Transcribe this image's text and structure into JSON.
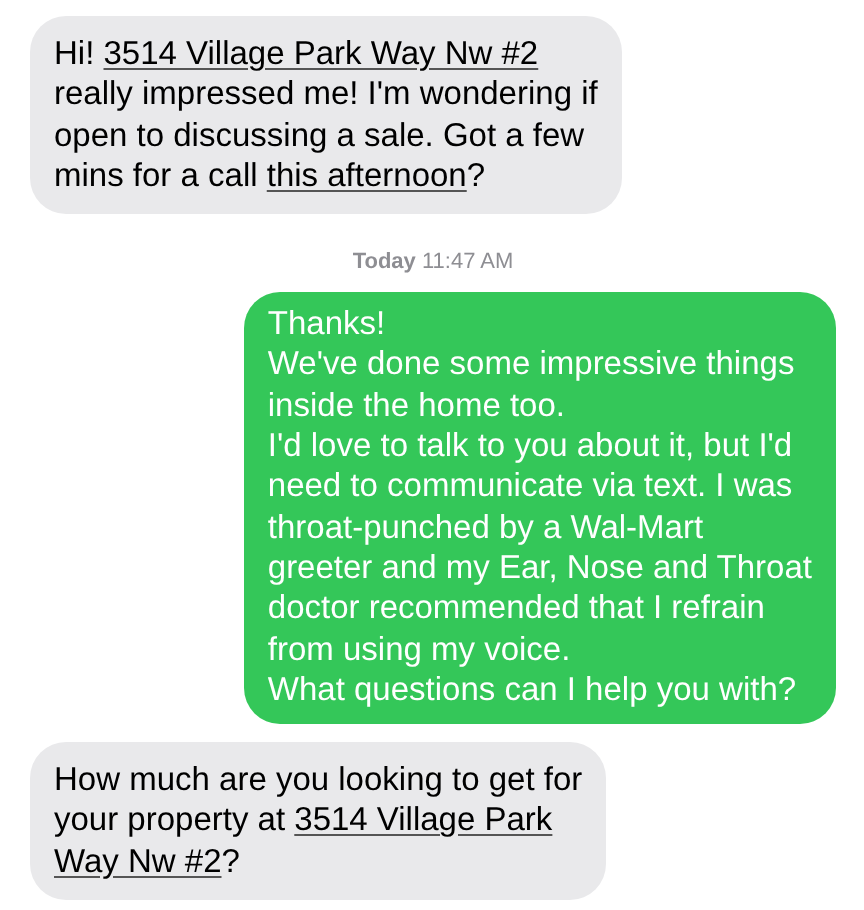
{
  "messages": [
    {
      "kind": "incoming",
      "lines": [
        [
          {
            "kind": "text",
            "text": "Hi! "
          },
          {
            "kind": "link",
            "text": "3514 Village Park Way Nw #2"
          }
        ],
        [
          {
            "kind": "text",
            "text": "really impressed me! I'm wondering if"
          }
        ],
        [
          {
            "kind": "text",
            "text": "open to discussing a sale. Got a few"
          }
        ],
        [
          {
            "kind": "text",
            "text": "mins for a call "
          },
          {
            "kind": "link",
            "text": "this afternoon"
          },
          {
            "kind": "text",
            "text": "?"
          }
        ]
      ]
    },
    {
      "kind": "timestamp",
      "text": "**Today** 11:47 AM"
    },
    {
      "kind": "outgoing",
      "lines": [
        [
          {
            "kind": "text",
            "text": "Thanks!"
          }
        ],
        [
          {
            "kind": "text",
            "text": "We've done some impressive things"
          }
        ],
        [
          {
            "kind": "text",
            "text": "inside the home too."
          }
        ],
        [
          {
            "kind": "text",
            "text": "I'd love to talk to you about it, but I'd"
          }
        ],
        [
          {
            "kind": "text",
            "text": "need to communicate via text. I was"
          }
        ],
        [
          {
            "kind": "text",
            "text": "throat-punched by a Wal-Mart"
          }
        ],
        [
          {
            "kind": "text",
            "text": "greeter and my Ear, Nose and Throat"
          }
        ],
        [
          {
            "kind": "text",
            "text": "doctor recommended that I refrain"
          }
        ],
        [
          {
            "kind": "text",
            "text": "from using my voice."
          }
        ],
        [
          {
            "kind": "text",
            "text": "What questions can I help you with?"
          }
        ]
      ]
    },
    {
      "kind": "incoming",
      "lines": [
        [
          {
            "kind": "text",
            "text": "How much are you looking to get for"
          }
        ],
        [
          {
            "kind": "text",
            "text": "your property at "
          },
          {
            "kind": "link",
            "text": "3514 Village Park"
          }
        ],
        [
          {
            "kind": "link",
            "text": "Way Nw #2"
          },
          {
            "kind": "text",
            "text": "?"
          }
        ]
      ]
    }
  ]
}
